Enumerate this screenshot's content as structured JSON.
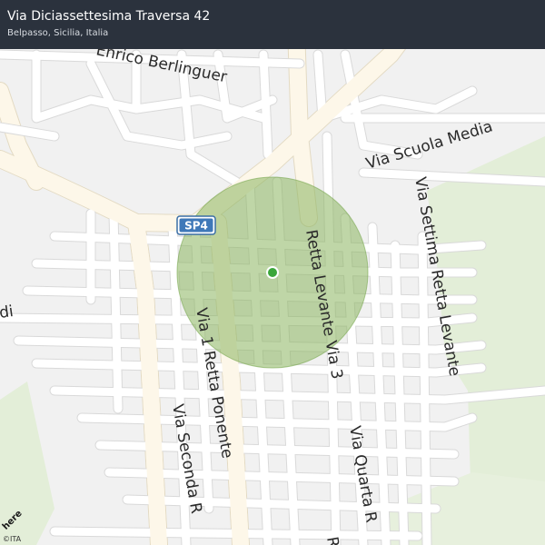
{
  "header": {
    "title": "Via Diciassettesima Traversa 42",
    "subtitle": "Belpasso, Sicilia, Italia"
  },
  "map": {
    "road_shield": "SP4",
    "street_labels": [
      "Via Scuola Media",
      "Via Settima Retta Levante",
      "Retta Levante Via 3",
      "Via 1 Retta Ponente",
      "Via Seconda R",
      "Via Quarta R",
      "Enrico Berlinguer",
      "di",
      "R"
    ],
    "marker_color": "#3aa63a",
    "radius_color": "#9dc37a",
    "park_color": "#e4efd9"
  },
  "footer": {
    "logo_text": "here",
    "copyright": "©ITA"
  }
}
